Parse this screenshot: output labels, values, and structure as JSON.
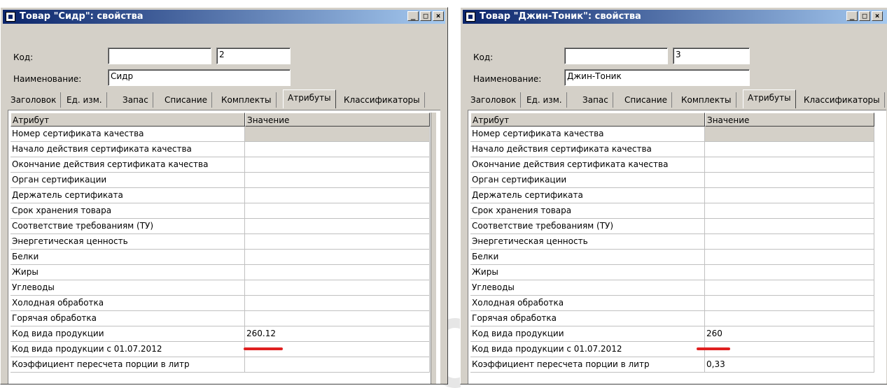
{
  "windows": [
    {
      "title": "Товар \"Сидр\": свойства",
      "controls": {
        "minimize": "_",
        "maximize": "□",
        "close": "×"
      },
      "fields": {
        "code_label": "Код:",
        "code_value": "",
        "code_number": "2",
        "name_label": "Наименование:",
        "name_value": "Сидр"
      },
      "tabs": [
        "Заголовок",
        "Ед. изм.",
        "Запас",
        "Списание",
        "Комплекты",
        "Атрибуты",
        "Классификаторы"
      ],
      "active_tab": "Атрибуты",
      "table": {
        "columns": [
          "Атрибут",
          "Значение"
        ],
        "rows": [
          {
            "attr": "Номер сертификата качества",
            "value": ""
          },
          {
            "attr": "Начало действия сертификата качества",
            "value": ""
          },
          {
            "attr": "Окончание действия сертификата качества",
            "value": ""
          },
          {
            "attr": "Орган сертификации",
            "value": ""
          },
          {
            "attr": "Держатель сертификата",
            "value": ""
          },
          {
            "attr": "Срок хранения товара",
            "value": ""
          },
          {
            "attr": "Соответствие требованиям (ТУ)",
            "value": ""
          },
          {
            "attr": "Энергетическая ценность",
            "value": ""
          },
          {
            "attr": "Белки",
            "value": ""
          },
          {
            "attr": "Жиры",
            "value": ""
          },
          {
            "attr": "Углеводы",
            "value": ""
          },
          {
            "attr": "Холодная обработка",
            "value": ""
          },
          {
            "attr": "Горячая обработка",
            "value": ""
          },
          {
            "attr": "Код вида продукции",
            "value": "260.12"
          },
          {
            "attr": "Код вида продукции с 01.07.2012",
            "value": ""
          },
          {
            "attr": "Коэффициент пересчета порции в литр",
            "value": ""
          }
        ]
      }
    },
    {
      "title": "Товар \"Джин-Тоник\": свойства",
      "controls": {
        "minimize": "_",
        "maximize": "□",
        "close": "×"
      },
      "fields": {
        "code_label": "Код:",
        "code_value": "",
        "code_number": "3",
        "name_label": "Наименование:",
        "name_value": "Джин-Тоник"
      },
      "tabs": [
        "Заголовок",
        "Ед. изм.",
        "Запас",
        "Списание",
        "Комплекты",
        "Атрибуты",
        "Классификаторы"
      ],
      "active_tab": "Атрибуты",
      "table": {
        "columns": [
          "Атрибут",
          "Значение"
        ],
        "rows": [
          {
            "attr": "Номер сертификата качества",
            "value": ""
          },
          {
            "attr": "Начало действия сертификата качества",
            "value": ""
          },
          {
            "attr": "Окончание действия сертификата качества",
            "value": ""
          },
          {
            "attr": "Орган сертификации",
            "value": ""
          },
          {
            "attr": "Держатель сертификата",
            "value": ""
          },
          {
            "attr": "Срок хранения товара",
            "value": ""
          },
          {
            "attr": "Соответствие требованиям (ТУ)",
            "value": ""
          },
          {
            "attr": "Энергетическая ценность",
            "value": ""
          },
          {
            "attr": "Белки",
            "value": ""
          },
          {
            "attr": "Жиры",
            "value": ""
          },
          {
            "attr": "Углеводы",
            "value": ""
          },
          {
            "attr": "Холодная обработка",
            "value": ""
          },
          {
            "attr": "Горячая обработка",
            "value": ""
          },
          {
            "attr": "Код вида продукции",
            "value": "260"
          },
          {
            "attr": "Код вида продукции с 01.07.2012",
            "value": ""
          },
          {
            "attr": "Коэффициент пересчета порции в литр",
            "value": "0,33"
          }
        ]
      }
    }
  ],
  "colors": {
    "titlebar_start": "#0a246a",
    "titlebar_end": "#a6caf0",
    "highlight_underline": "#e02020",
    "window_bg": "#d4d0c8"
  }
}
